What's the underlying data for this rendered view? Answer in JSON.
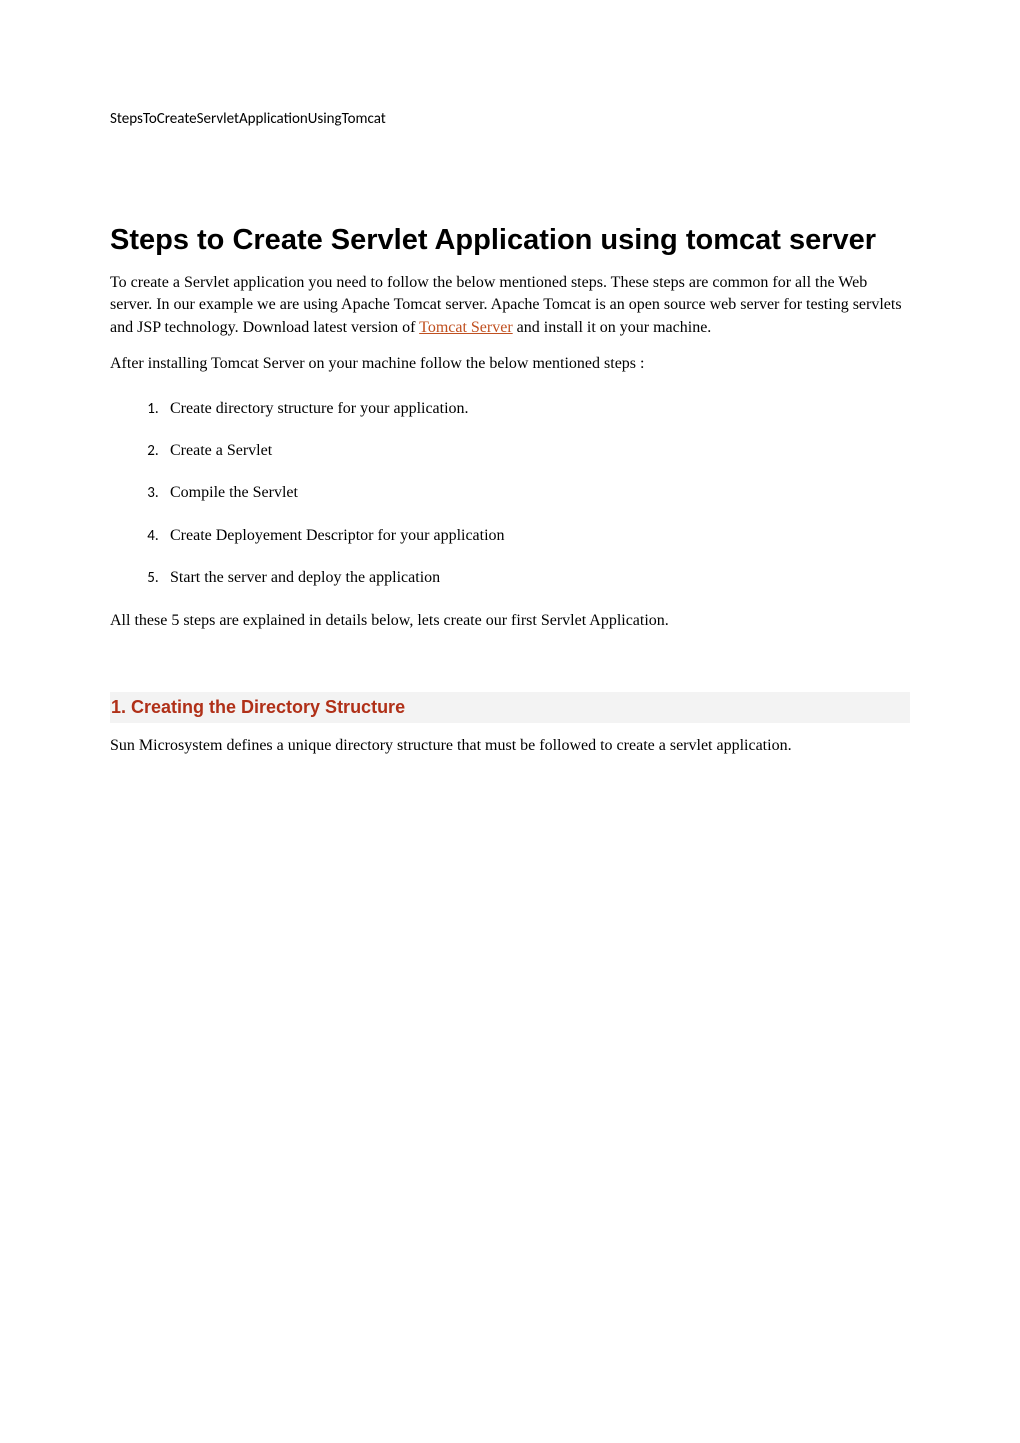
{
  "header": "StepsToCreateServletApplicationUsingTomcat",
  "title": "Steps to Create Servlet Application using tomcat server",
  "intro": {
    "part1": "To create a Servlet application you need to follow the below mentioned steps. These steps are common for all the Web server. In our example we are using Apache Tomcat server. Apache Tomcat is an open source web server for testing servlets and JSP technology. Download latest version of ",
    "link": "Tomcat Server",
    "part2": " and install it on your machine."
  },
  "afterIntro": "After installing Tomcat Server on your machine follow the below mentioned steps :",
  "steps": [
    "Create directory structure for your application.",
    "Create a Servlet",
    "Compile the Servlet",
    "Create Deployement Descriptor for your application",
    "Start the server and deploy the application"
  ],
  "closing": "All these 5 steps are explained in details below, lets create our first Servlet Application.",
  "section1": {
    "heading": "1. Creating the Directory Structure",
    "body": "Sun Microsystem defines a unique directory structure that must be followed to create a servlet application."
  }
}
